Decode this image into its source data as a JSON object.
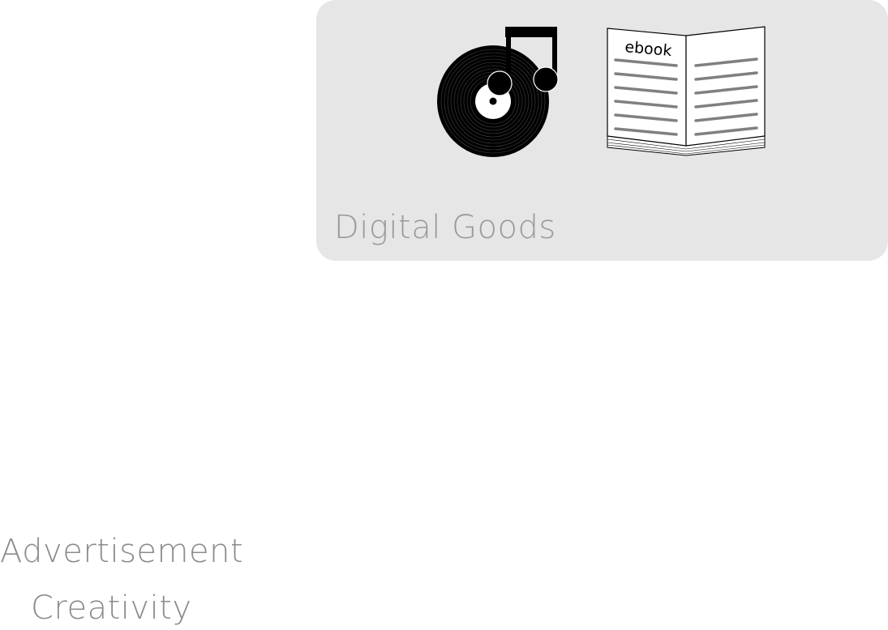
{
  "card": {
    "title": "Digital Goods",
    "ebook_text": "ebook",
    "icons": [
      "music-vinyl-icon",
      "ebook-icon"
    ]
  },
  "labels": {
    "advertisement": "Advertisement",
    "creativity": "Creativity"
  },
  "colors": {
    "card_bg": "#e6e6e6",
    "title_text": "#9a9a9a",
    "side_text": "#8c8c8c",
    "icon_dark": "#000000",
    "ebook_lines": "#808080"
  }
}
